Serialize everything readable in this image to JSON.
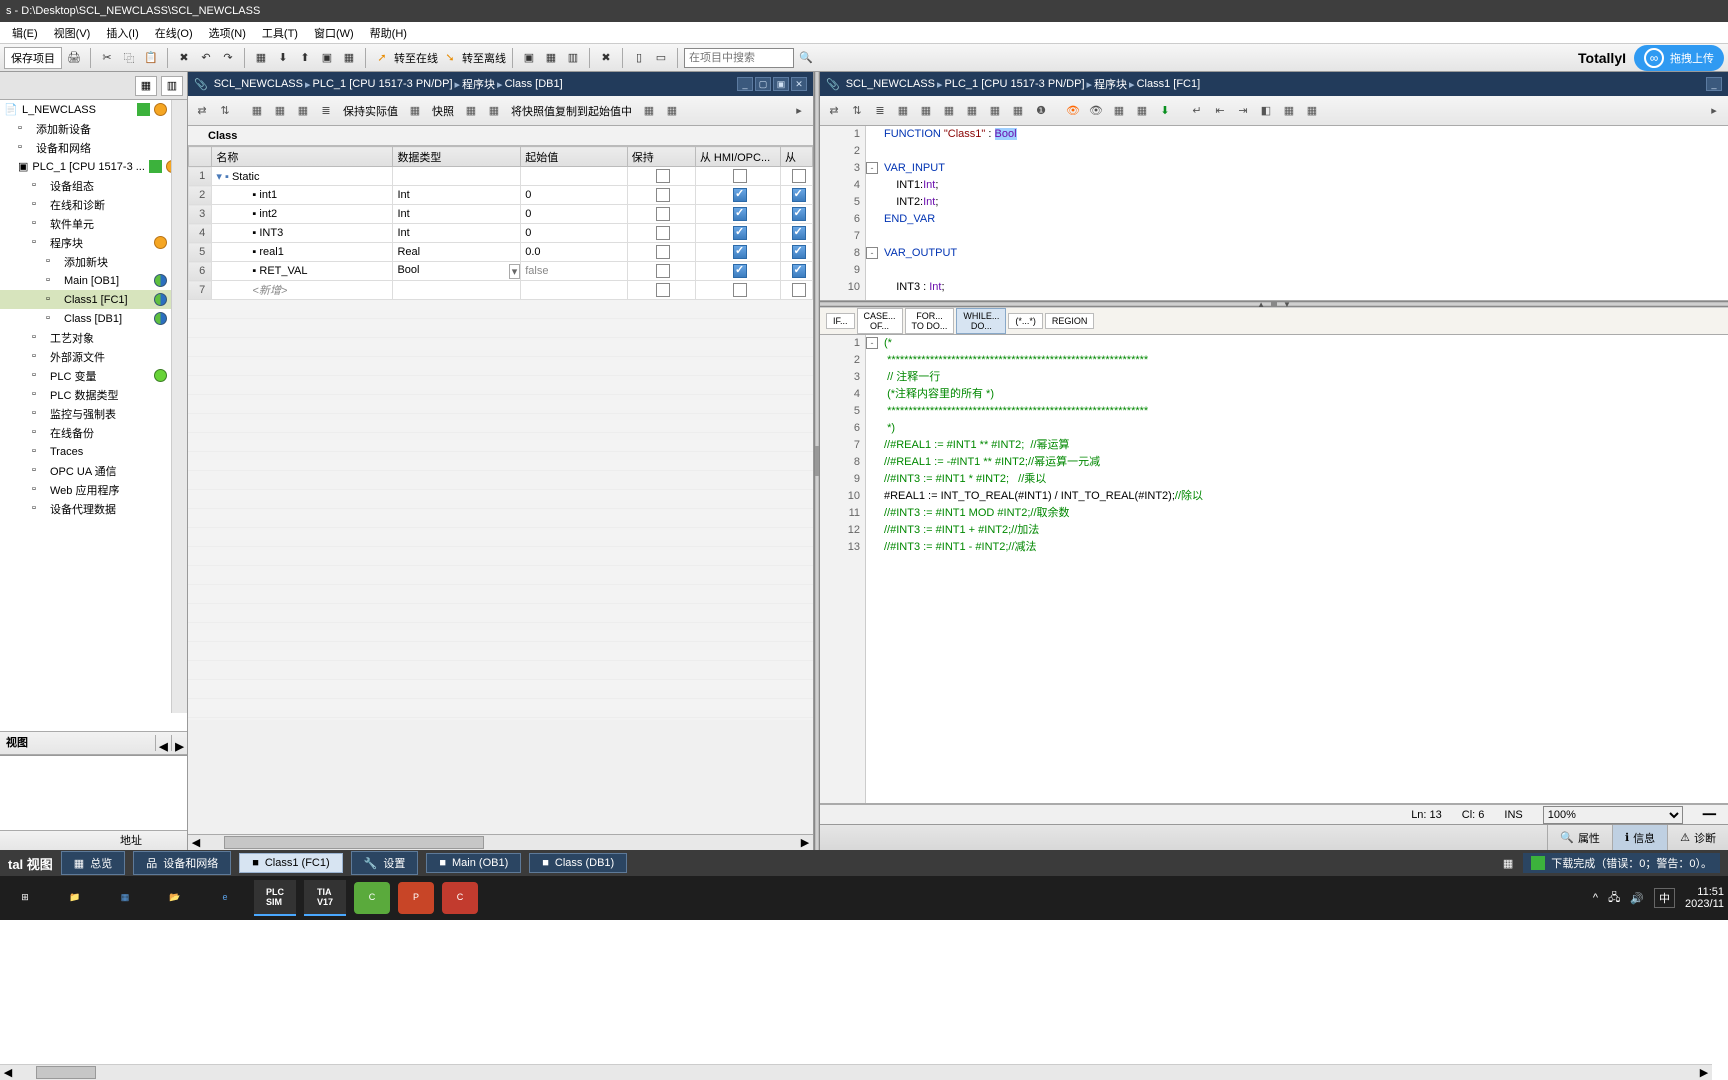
{
  "title": "s - D:\\Desktop\\SCL_NEWCLASS\\SCL_NEWCLASS",
  "menu": [
    "辑(E)",
    "视图(V)",
    "插入(I)",
    "在线(O)",
    "选项(N)",
    "工具(T)",
    "窗口(W)",
    "帮助(H)"
  ],
  "toolbar": {
    "save_label": "保存项目",
    "go_online": "转至在线",
    "go_offline": "转至离线",
    "search_placeholder": "在项目中搜索"
  },
  "brand": "TotallyI",
  "cloud_button": "拖拽上传",
  "tree": {
    "items": [
      {
        "label": "L_NEWCLASS",
        "indent": 0,
        "status": [
          "green",
          "orange"
        ],
        "kind": "root"
      },
      {
        "label": "添加新设备",
        "indent": 1
      },
      {
        "label": "设备和网络",
        "indent": 1
      },
      {
        "label": "PLC_1 [CPU 1517-3 ...",
        "indent": 1,
        "status": [
          "green",
          "orange"
        ],
        "kind": "plc"
      },
      {
        "label": "设备组态",
        "indent": 2
      },
      {
        "label": "在线和诊断",
        "indent": 2
      },
      {
        "label": "软件单元",
        "indent": 2
      },
      {
        "label": "程序块",
        "indent": 2,
        "status": [
          "orange"
        ]
      },
      {
        "label": "添加新块",
        "indent": 3
      },
      {
        "label": "Main [OB1]",
        "indent": 3,
        "status": [
          "half1"
        ]
      },
      {
        "label": "Class1 [FC1]",
        "indent": 3,
        "status": [
          "half2"
        ],
        "sel": true
      },
      {
        "label": "Class [DB1]",
        "indent": 3,
        "status": [
          "half1"
        ]
      },
      {
        "label": "工艺对象",
        "indent": 2
      },
      {
        "label": "外部源文件",
        "indent": 2
      },
      {
        "label": "PLC 变量",
        "indent": 2,
        "status": [
          "greenfull"
        ]
      },
      {
        "label": "PLC 数据类型",
        "indent": 2
      },
      {
        "label": "监控与强制表",
        "indent": 2
      },
      {
        "label": "在线备份",
        "indent": 2
      },
      {
        "label": "Traces",
        "indent": 2
      },
      {
        "label": "OPC UA 通信",
        "indent": 2
      },
      {
        "label": "Web 应用程序",
        "indent": 2
      },
      {
        "label": "设备代理数据",
        "indent": 2
      }
    ]
  },
  "view_label": "视图",
  "addr_label": "地址",
  "db_panel": {
    "crumbs": [
      "SCL_NEWCLASS",
      "PLC_1 [CPU 1517-3 PN/DP]",
      "程序块",
      "Class [DB1]"
    ],
    "toolbar": {
      "keep": "保持实际值",
      "snapshot": "快照",
      "copy_snapshot": "将快照值复制到起始值中"
    },
    "section": "Class",
    "cols": [
      "",
      "名称",
      "数据类型",
      "起始值",
      "保持",
      "从 HMI/OPC...",
      "从"
    ],
    "rows": [
      {
        "n": "1",
        "name": "Static",
        "type": "",
        "start": "",
        "struct": true
      },
      {
        "n": "2",
        "name": "int1",
        "type": "Int",
        "start": "0",
        "hmi": true,
        "last": true
      },
      {
        "n": "3",
        "name": "int2",
        "type": "Int",
        "start": "0",
        "hmi": true,
        "last": true
      },
      {
        "n": "4",
        "name": "INT3",
        "type": "Int",
        "start": "0",
        "hmi": true,
        "last": true
      },
      {
        "n": "5",
        "name": "real1",
        "type": "Real",
        "start": "0.0",
        "hmi": true,
        "last": true
      },
      {
        "n": "6",
        "name": "RET_VAL",
        "type": "Bool",
        "start": "false",
        "start_gray": true,
        "hmi": true,
        "last": true,
        "dd": true
      },
      {
        "n": "7",
        "name": "<新增>",
        "placeholder": true
      }
    ]
  },
  "fc_panel": {
    "crumbs": [
      "SCL_NEWCLASS",
      "PLC_1 [CPU 1517-3 PN/DP]",
      "程序块",
      "Class1 [FC1]"
    ],
    "decl_lines": [
      {
        "n": 1,
        "html": "<span class='kw'>FUNCTION</span> <span class='str'>\"Class1\"</span> : <span class='hl type'>Bool</span>"
      },
      {
        "n": 2,
        "html": ""
      },
      {
        "n": 3,
        "html": "<span class='kw'>VAR_INPUT</span>",
        "fold": "-"
      },
      {
        "n": 4,
        "html": "    INT1:<span class='type'>Int</span>;"
      },
      {
        "n": 5,
        "html": "    INT2:<span class='type'>Int</span>;"
      },
      {
        "n": 6,
        "html": "<span class='kw'>END_VAR</span>"
      },
      {
        "n": 7,
        "html": ""
      },
      {
        "n": 8,
        "html": "<span class='kw'>VAR_OUTPUT</span>",
        "fold": "-"
      },
      {
        "n": 9,
        "html": ""
      },
      {
        "n": 10,
        "html": "    INT3 : <span class='type'>Int</span>;"
      }
    ],
    "chips": [
      "IF...",
      "CASE... OF...",
      "FOR... TO DO...",
      "WHILE... DO...",
      "(*...*)",
      "REGION"
    ],
    "body_lines": [
      {
        "n": 1,
        "html": "<span class='comment'>(*</span>",
        "fold": "-"
      },
      {
        "n": 2,
        "html": " <span class='comment'>*************************************************************</span>"
      },
      {
        "n": 3,
        "html": " <span class='comment'>// 注释一行</span>"
      },
      {
        "n": 4,
        "html": " <span class='comment'>(*注释内容里的所有 *)</span>"
      },
      {
        "n": 5,
        "html": " <span class='comment'>*************************************************************</span>"
      },
      {
        "n": 6,
        "html": " <span class='comment'>*)</span>"
      },
      {
        "n": 7,
        "html": "<span class='comment'>//#REAL1 := #INT1 ** #INT2;  //幂运算</span>"
      },
      {
        "n": 8,
        "html": "<span class='comment'>//#REAL1 := -#INT1 ** #INT2;//幂运算一元减</span>"
      },
      {
        "n": 9,
        "html": "<span class='comment'>//#INT3 := #INT1 * #INT2;   //乘以</span>"
      },
      {
        "n": 10,
        "html": "#REAL1 := INT_TO_REAL(#INT1) / INT_TO_REAL(#INT2);<span class='comment'>//除以</span>"
      },
      {
        "n": 11,
        "html": "<span class='comment'>//#INT3 := #INT1 MOD #INT2;//取余数</span>"
      },
      {
        "n": 12,
        "html": "<span class='comment'>//#INT3 := #INT1 + #INT2;//加法</span>"
      },
      {
        "n": 13,
        "html": "<span class='comment'>//#INT3 := #INT1 - #INT2;//减法</span>"
      }
    ],
    "status": {
      "ln": "Ln: 13",
      "col": "Cl: 6",
      "ins": "INS",
      "zoom": "100%"
    }
  },
  "footer_tabs": [
    {
      "icon": "🔍",
      "label": "属性"
    },
    {
      "icon": "ℹ",
      "label": "信息",
      "active": true
    },
    {
      "icon": "⚠",
      "label": "诊断"
    }
  ],
  "task_tiles": [
    {
      "label": "tal 视图",
      "strong": true
    },
    {
      "label": "总览",
      "icon": "▦"
    },
    {
      "label": "设备和网络",
      "icon": "品"
    },
    {
      "label": "Class1 (FC1)",
      "icon": "■",
      "highlight": true
    },
    {
      "label": "设置",
      "icon": "🔧"
    },
    {
      "label": "Main (OB1)",
      "icon": "■"
    },
    {
      "label": "Class (DB1)",
      "icon": "■"
    }
  ],
  "download_status": "下载完成（错误：0；警告：0）。",
  "systray": {
    "ime": "中",
    "time": "11:51",
    "date": "2023/11"
  }
}
